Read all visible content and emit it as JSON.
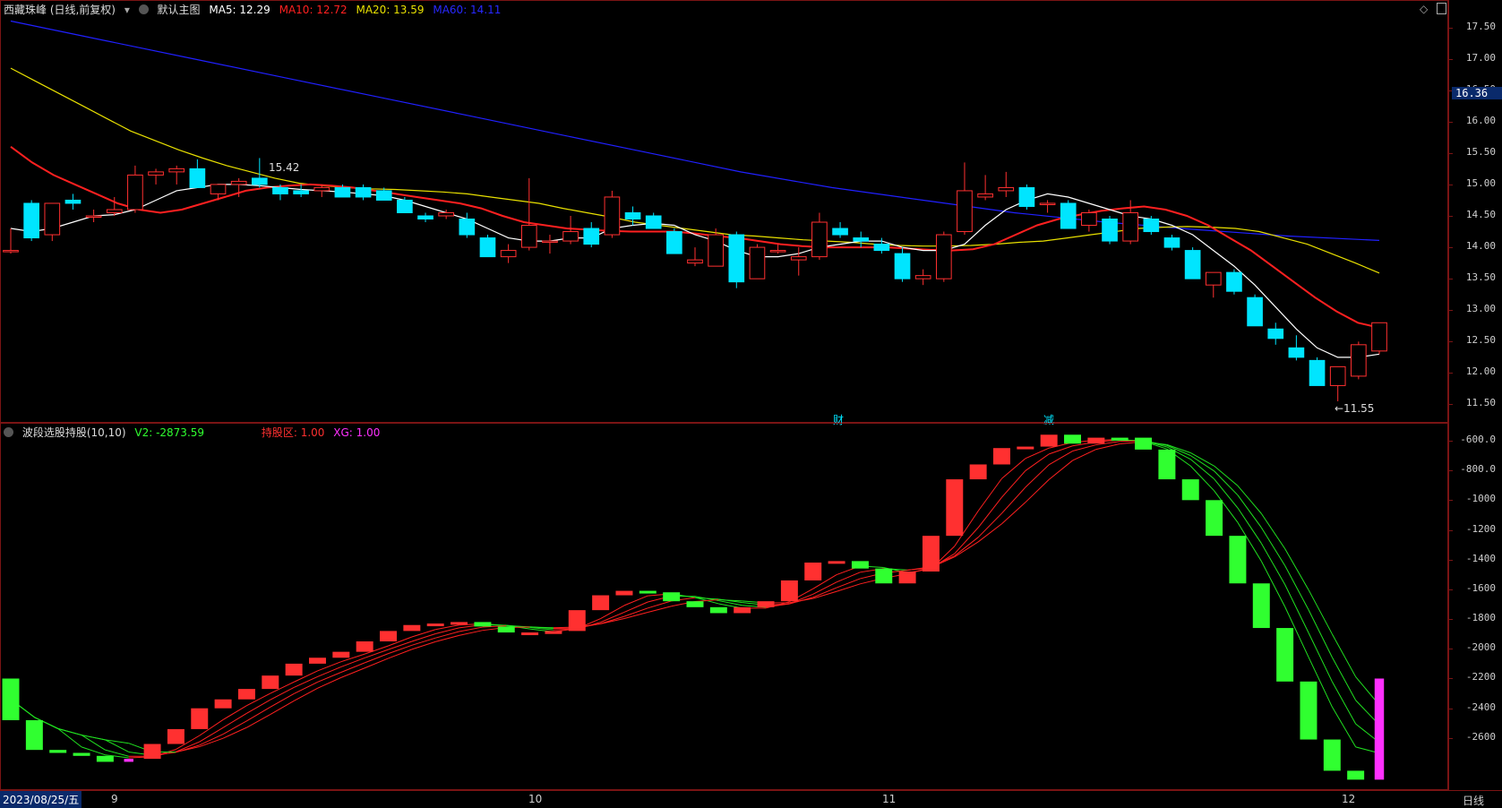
{
  "main": {
    "stock_name": "西藏珠峰 (日线,前复权)",
    "layout_label": "默认主图",
    "ma5": "MA5: 12.29",
    "ma10": "MA10: 12.72",
    "ma20": "MA20: 13.59",
    "ma60": "MA60: 14.11",
    "colors": {
      "ma5": "#ffffff",
      "ma10": "#ff2020",
      "ma20": "#e8e000",
      "ma60": "#2020ff",
      "up": "#ff3030",
      "down": "#00e5ff"
    },
    "price_ticks": [
      "17.50",
      "17.00",
      "16.50",
      "16.00",
      "15.50",
      "15.00",
      "14.50",
      "14.00",
      "13.50",
      "13.00",
      "12.50",
      "12.00",
      "11.50"
    ],
    "current_price": "16.36",
    "high_mark": "15.42",
    "low_mark": "←11.55",
    "event_tags": [
      "财",
      "减"
    ]
  },
  "indicator": {
    "name": "波段选股持股(10,10)",
    "v2": "V2: -2873.59",
    "zone": "持股区: 1.00",
    "xg": "XG: 1.00",
    "colors": {
      "zone": "#ff3030",
      "xg": "#ff30ff",
      "v2": "#30ff30"
    },
    "value_ticks": [
      "-600.0",
      "-800.0",
      "-1000",
      "-1200",
      "-1400",
      "-1600",
      "-1800",
      "-2000",
      "-2200",
      "-2400",
      "-2600"
    ]
  },
  "footer": {
    "start_date": "2023/08/25/五",
    "months": [
      "9",
      "10",
      "11",
      "12"
    ],
    "period": "日线"
  },
  "chart_data": {
    "type": "candlestick",
    "ylim": [
      11.35,
      17.65
    ],
    "candles": [
      {
        "o": 13.95,
        "h": 14.3,
        "l": 13.9,
        "c": 13.95
      },
      {
        "o": 14.7,
        "h": 14.75,
        "l": 14.1,
        "c": 14.15
      },
      {
        "o": 14.2,
        "h": 14.7,
        "l": 14.1,
        "c": 14.7
      },
      {
        "o": 14.75,
        "h": 14.85,
        "l": 14.6,
        "c": 14.7
      },
      {
        "o": 14.5,
        "h": 14.6,
        "l": 14.4,
        "c": 14.5
      },
      {
        "o": 14.55,
        "h": 14.8,
        "l": 14.5,
        "c": 14.6
      },
      {
        "o": 14.6,
        "h": 15.3,
        "l": 14.55,
        "c": 15.15
      },
      {
        "o": 15.15,
        "h": 15.25,
        "l": 15.0,
        "c": 15.2
      },
      {
        "o": 15.2,
        "h": 15.3,
        "l": 15.0,
        "c": 15.25
      },
      {
        "o": 15.25,
        "h": 15.4,
        "l": 14.95,
        "c": 14.95
      },
      {
        "o": 14.85,
        "h": 15.0,
        "l": 14.75,
        "c": 15.0
      },
      {
        "o": 15.0,
        "h": 15.1,
        "l": 14.8,
        "c": 15.05
      },
      {
        "o": 15.1,
        "h": 15.42,
        "l": 14.95,
        "c": 15.0
      },
      {
        "o": 14.95,
        "h": 15.0,
        "l": 14.75,
        "c": 14.85
      },
      {
        "o": 14.9,
        "h": 15.0,
        "l": 14.8,
        "c": 14.85
      },
      {
        "o": 14.9,
        "h": 15.0,
        "l": 14.8,
        "c": 14.95
      },
      {
        "o": 14.95,
        "h": 15.0,
        "l": 14.8,
        "c": 14.8
      },
      {
        "o": 14.95,
        "h": 15.0,
        "l": 14.75,
        "c": 14.8
      },
      {
        "o": 14.9,
        "h": 14.95,
        "l": 14.8,
        "c": 14.75
      },
      {
        "o": 14.75,
        "h": 14.8,
        "l": 14.55,
        "c": 14.55
      },
      {
        "o": 14.5,
        "h": 14.55,
        "l": 14.4,
        "c": 14.45
      },
      {
        "o": 14.5,
        "h": 14.6,
        "l": 14.45,
        "c": 14.55
      },
      {
        "o": 14.45,
        "h": 14.55,
        "l": 14.15,
        "c": 14.2
      },
      {
        "o": 14.15,
        "h": 14.2,
        "l": 13.85,
        "c": 13.85
      },
      {
        "o": 13.85,
        "h": 14.05,
        "l": 13.75,
        "c": 13.95
      },
      {
        "o": 14.0,
        "h": 15.1,
        "l": 13.95,
        "c": 14.35
      },
      {
        "o": 14.1,
        "h": 14.2,
        "l": 13.9,
        "c": 14.1
      },
      {
        "o": 14.1,
        "h": 14.5,
        "l": 14.05,
        "c": 14.25
      },
      {
        "o": 14.3,
        "h": 14.4,
        "l": 14.0,
        "c": 14.05
      },
      {
        "o": 14.2,
        "h": 14.9,
        "l": 14.15,
        "c": 14.8
      },
      {
        "o": 14.55,
        "h": 14.65,
        "l": 14.35,
        "c": 14.45
      },
      {
        "o": 14.5,
        "h": 14.55,
        "l": 14.3,
        "c": 14.3
      },
      {
        "o": 14.25,
        "h": 14.3,
        "l": 13.9,
        "c": 13.9
      },
      {
        "o": 13.75,
        "h": 14.0,
        "l": 13.7,
        "c": 13.8
      },
      {
        "o": 13.7,
        "h": 14.3,
        "l": 13.7,
        "c": 14.2
      },
      {
        "o": 14.2,
        "h": 14.25,
        "l": 13.35,
        "c": 13.45
      },
      {
        "o": 13.5,
        "h": 14.05,
        "l": 13.5,
        "c": 14.0
      },
      {
        "o": 13.95,
        "h": 14.05,
        "l": 13.9,
        "c": 13.95
      },
      {
        "o": 13.8,
        "h": 14.0,
        "l": 13.55,
        "c": 13.85
      },
      {
        "o": 13.85,
        "h": 14.55,
        "l": 13.8,
        "c": 14.4
      },
      {
        "o": 14.3,
        "h": 14.4,
        "l": 14.15,
        "c": 14.2
      },
      {
        "o": 14.15,
        "h": 14.25,
        "l": 14.0,
        "c": 14.1
      },
      {
        "o": 14.05,
        "h": 14.15,
        "l": 13.9,
        "c": 13.95
      },
      {
        "o": 13.9,
        "h": 14.0,
        "l": 13.45,
        "c": 13.5
      },
      {
        "o": 13.5,
        "h": 13.65,
        "l": 13.4,
        "c": 13.55
      },
      {
        "o": 13.5,
        "h": 14.25,
        "l": 13.45,
        "c": 14.2
      },
      {
        "o": 14.25,
        "h": 15.35,
        "l": 14.2,
        "c": 14.9
      },
      {
        "o": 14.8,
        "h": 15.15,
        "l": 14.75,
        "c": 14.85
      },
      {
        "o": 14.9,
        "h": 15.2,
        "l": 14.8,
        "c": 14.95
      },
      {
        "o": 14.95,
        "h": 15.0,
        "l": 14.6,
        "c": 14.65
      },
      {
        "o": 14.7,
        "h": 14.75,
        "l": 14.55,
        "c": 14.7
      },
      {
        "o": 14.7,
        "h": 14.75,
        "l": 14.3,
        "c": 14.3
      },
      {
        "o": 14.35,
        "h": 14.6,
        "l": 14.25,
        "c": 14.55
      },
      {
        "o": 14.45,
        "h": 14.5,
        "l": 14.05,
        "c": 14.1
      },
      {
        "o": 14.1,
        "h": 14.75,
        "l": 14.05,
        "c": 14.55
      },
      {
        "o": 14.45,
        "h": 14.5,
        "l": 14.2,
        "c": 14.25
      },
      {
        "o": 14.15,
        "h": 14.2,
        "l": 13.95,
        "c": 14.0
      },
      {
        "o": 13.95,
        "h": 14.0,
        "l": 13.5,
        "c": 13.5
      },
      {
        "o": 13.4,
        "h": 13.6,
        "l": 13.2,
        "c": 13.6
      },
      {
        "o": 13.6,
        "h": 13.65,
        "l": 13.25,
        "c": 13.3
      },
      {
        "o": 13.2,
        "h": 13.25,
        "l": 12.75,
        "c": 12.75
      },
      {
        "o": 12.7,
        "h": 12.8,
        "l": 12.45,
        "c": 12.55
      },
      {
        "o": 12.4,
        "h": 12.6,
        "l": 12.2,
        "c": 12.25
      },
      {
        "o": 12.2,
        "h": 12.25,
        "l": 11.8,
        "c": 11.8
      },
      {
        "o": 11.8,
        "h": 12.1,
        "l": 11.55,
        "c": 12.1
      },
      {
        "o": 11.95,
        "h": 12.5,
        "l": 11.9,
        "c": 12.45
      },
      {
        "o": 12.35,
        "h": 12.8,
        "l": 12.3,
        "c": 12.8
      }
    ],
    "ma5_line": [
      14.3,
      14.25,
      14.3,
      14.4,
      14.5,
      14.52,
      14.6,
      14.75,
      14.9,
      14.95,
      15.0,
      15.0,
      14.98,
      14.95,
      14.92,
      14.9,
      14.88,
      14.85,
      14.82,
      14.75,
      14.65,
      14.55,
      14.45,
      14.3,
      14.15,
      14.1,
      14.1,
      14.15,
      14.15,
      14.3,
      14.35,
      14.38,
      14.35,
      14.2,
      14.1,
      13.95,
      13.85,
      13.85,
      13.9,
      14.0,
      14.05,
      14.1,
      14.1,
      14.0,
      13.95,
      13.95,
      14.05,
      14.35,
      14.6,
      14.75,
      14.85,
      14.8,
      14.7,
      14.6,
      14.5,
      14.45,
      14.35,
      14.2,
      13.95,
      13.7,
      13.4,
      13.05,
      12.7,
      12.4,
      12.25,
      12.25,
      12.3
    ],
    "ma10_line": [
      15.6,
      15.35,
      15.15,
      15.0,
      14.85,
      14.7,
      14.6,
      14.55,
      14.6,
      14.7,
      14.8,
      14.9,
      14.95,
      14.98,
      15.0,
      14.98,
      14.95,
      14.9,
      14.85,
      14.8,
      14.75,
      14.7,
      14.62,
      14.5,
      14.4,
      14.35,
      14.3,
      14.28,
      14.26,
      14.25,
      14.25,
      14.25,
      14.22,
      14.18,
      14.15,
      14.1,
      14.05,
      14.02,
      14.0,
      14.0,
      14.0,
      14.0,
      13.98,
      13.96,
      13.95,
      13.97,
      14.05,
      14.2,
      14.35,
      14.45,
      14.52,
      14.58,
      14.62,
      14.65,
      14.6,
      14.5,
      14.35,
      14.15,
      13.95,
      13.7,
      13.45,
      13.2,
      12.98,
      12.8,
      12.72
    ],
    "ma20_line": [
      16.85,
      16.65,
      16.45,
      16.25,
      16.05,
      15.85,
      15.7,
      15.55,
      15.42,
      15.3,
      15.2,
      15.1,
      15.02,
      14.98,
      14.95,
      14.93,
      14.92,
      14.9,
      14.88,
      14.85,
      14.8,
      14.75,
      14.7,
      14.62,
      14.55,
      14.48,
      14.4,
      14.35,
      14.3,
      14.25,
      14.2,
      14.18,
      14.15,
      14.12,
      14.1,
      14.08,
      14.05,
      14.03,
      14.02,
      14.02,
      14.03,
      14.05,
      14.08,
      14.1,
      14.15,
      14.2,
      14.25,
      14.3,
      14.32,
      14.33,
      14.32,
      14.3,
      14.25,
      14.15,
      14.05,
      13.9,
      13.75,
      13.59
    ],
    "ma60_line": [
      17.6,
      17.3,
      17.0,
      16.7,
      16.4,
      16.1,
      15.8,
      15.5,
      15.2,
      14.95,
      14.75,
      14.55,
      14.4,
      14.28,
      14.18,
      14.11
    ],
    "indicator_bars": [
      {
        "o": -2200,
        "c": -2480,
        "color": "down"
      },
      {
        "o": -2480,
        "c": -2680,
        "color": "down"
      },
      {
        "o": -2680,
        "c": -2700,
        "color": "down"
      },
      {
        "o": -2700,
        "c": -2720,
        "color": "down"
      },
      {
        "o": -2720,
        "c": -2760,
        "color": "down"
      },
      {
        "o": -2760,
        "c": -2740,
        "color": "xg"
      },
      {
        "o": -2740,
        "c": -2640,
        "color": "up"
      },
      {
        "o": -2640,
        "c": -2540,
        "color": "up"
      },
      {
        "o": -2540,
        "c": -2400,
        "color": "up"
      },
      {
        "o": -2400,
        "c": -2340,
        "color": "up"
      },
      {
        "o": -2340,
        "c": -2270,
        "color": "up"
      },
      {
        "o": -2270,
        "c": -2180,
        "color": "up"
      },
      {
        "o": -2180,
        "c": -2100,
        "color": "up"
      },
      {
        "o": -2100,
        "c": -2060,
        "color": "up"
      },
      {
        "o": -2060,
        "c": -2020,
        "color": "up"
      },
      {
        "o": -2020,
        "c": -1950,
        "color": "up"
      },
      {
        "o": -1950,
        "c": -1880,
        "color": "up"
      },
      {
        "o": -1880,
        "c": -1840,
        "color": "up"
      },
      {
        "o": -1840,
        "c": -1830,
        "color": "up"
      },
      {
        "o": -1830,
        "c": -1820,
        "color": "up"
      },
      {
        "o": -1820,
        "c": -1850,
        "color": "down"
      },
      {
        "o": -1850,
        "c": -1890,
        "color": "down"
      },
      {
        "o": -1890,
        "c": -1900,
        "color": "up"
      },
      {
        "o": -1900,
        "c": -1880,
        "color": "up"
      },
      {
        "o": -1880,
        "c": -1740,
        "color": "up"
      },
      {
        "o": -1740,
        "c": -1640,
        "color": "up"
      },
      {
        "o": -1640,
        "c": -1610,
        "color": "up"
      },
      {
        "o": -1610,
        "c": -1620,
        "color": "down"
      },
      {
        "o": -1620,
        "c": -1680,
        "color": "down"
      },
      {
        "o": -1680,
        "c": -1720,
        "color": "down"
      },
      {
        "o": -1720,
        "c": -1760,
        "color": "down"
      },
      {
        "o": -1760,
        "c": -1720,
        "color": "up"
      },
      {
        "o": -1720,
        "c": -1680,
        "color": "up"
      },
      {
        "o": -1680,
        "c": -1540,
        "color": "up"
      },
      {
        "o": -1540,
        "c": -1420,
        "color": "up"
      },
      {
        "o": -1420,
        "c": -1410,
        "color": "up"
      },
      {
        "o": -1410,
        "c": -1460,
        "color": "down"
      },
      {
        "o": -1460,
        "c": -1560,
        "color": "down"
      },
      {
        "o": -1560,
        "c": -1480,
        "color": "up"
      },
      {
        "o": -1480,
        "c": -1240,
        "color": "up"
      },
      {
        "o": -1240,
        "c": -860,
        "color": "up"
      },
      {
        "o": -860,
        "c": -760,
        "color": "up"
      },
      {
        "o": -760,
        "c": -650,
        "color": "up"
      },
      {
        "o": -650,
        "c": -640,
        "color": "up"
      },
      {
        "o": -640,
        "c": -560,
        "color": "up"
      },
      {
        "o": -560,
        "c": -620,
        "color": "down"
      },
      {
        "o": -620,
        "c": -580,
        "color": "up"
      },
      {
        "o": -580,
        "c": -600,
        "color": "down"
      },
      {
        "o": -580,
        "c": -660,
        "color": "down"
      },
      {
        "o": -660,
        "c": -860,
        "color": "down"
      },
      {
        "o": -860,
        "c": -1000,
        "color": "down"
      },
      {
        "o": -1000,
        "c": -1240,
        "color": "down"
      },
      {
        "o": -1240,
        "c": -1560,
        "color": "down"
      },
      {
        "o": -1560,
        "c": -1860,
        "color": "down"
      },
      {
        "o": -1860,
        "c": -2220,
        "color": "down"
      },
      {
        "o": -2220,
        "c": -2610,
        "color": "down"
      },
      {
        "o": -2610,
        "c": -2820,
        "color": "down"
      },
      {
        "o": -2820,
        "c": -2880,
        "color": "down"
      },
      {
        "o": -2200,
        "c": -2880,
        "color": "xg"
      }
    ],
    "indicator_ylim": [
      -480,
      -2920
    ]
  }
}
